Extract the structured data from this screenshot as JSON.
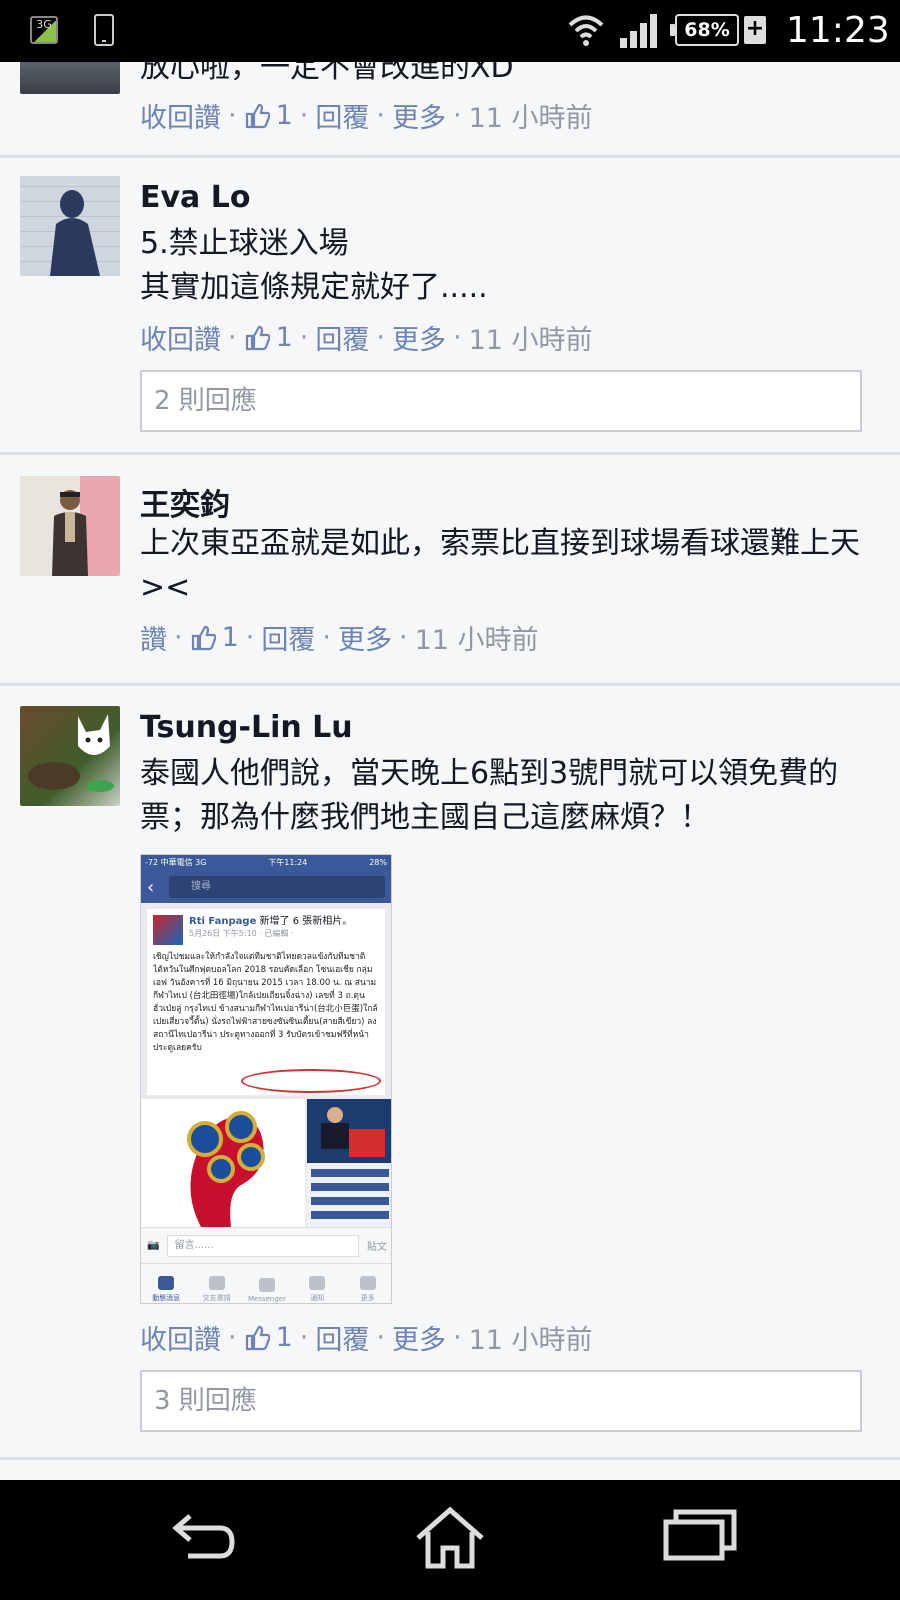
{
  "status_bar": {
    "network": "3G",
    "battery": "68%",
    "charging": "+",
    "time": "11:23"
  },
  "comments": [
    {
      "author": "",
      "text": "放心啦，一定不會改進的XD",
      "actions": {
        "like": "收回讚",
        "likes": "1",
        "reply": "回覆",
        "more": "更多",
        "time": "11 小時前"
      }
    },
    {
      "author": "Eva Lo",
      "text": "5.禁止球迷入場\n其實加這條規定就好了.....",
      "actions": {
        "like": "收回讚",
        "likes": "1",
        "reply": "回覆",
        "more": "更多",
        "time": "11 小時前"
      },
      "replies": "2 則回應"
    },
    {
      "author": "王奕鈞",
      "text": "上次東亞盃就是如此，索票比直接到球場看球還難上天><",
      "actions": {
        "like": "讚",
        "likes": "1",
        "reply": "回覆",
        "more": "更多",
        "time": "11 小時前"
      }
    },
    {
      "author": "Tsung-Lin Lu",
      "text": "泰國人他們說，當天晚上6點到3號門就可以領免費的票；那為什麼我們地主國自己這麼麻煩？！",
      "actions": {
        "like": "收回讚",
        "likes": "1",
        "reply": "回覆",
        "more": "更多",
        "time": "11 小時前"
      },
      "replies": "3 則回應",
      "attachment": {
        "status_left": "-72 中華電信 3G",
        "status_mid": "下午11:24",
        "status_right": "28%",
        "search_placeholder": "搜尋",
        "page_name": "Rti Fanpage",
        "page_action": "新增了 6 張新相片。",
        "page_date": "5月26日 下午5:10 · 已編輯 ·",
        "thai_text": "เชิญไปชมและให้กำลังใจแด่ทีมชาติไทยดวลแข้งกับทีมชาติไต้หวันในศึกฟุตบอลโลก 2018 รอบคัดเลือก โซนเอเชีย กลุ่มเอฟ วันอังคารที่ 16 มิถุนายน 2015 เวลา 18.00 น. ณ สนามกีฬาไทเป (台北田徑場)ใกล้เปยเถียนจิ๋งฉ่าง) เลขที่ 3 ถ.ตุนฮั่วเป่ยลู่ กรุงไทเป ข้างสนามกีฬาไทเปอารีน่า(台北小巨蛋)ใกล้เปยเสี่ยวจวี้ตั้น) นั่งรถไฟฟ้าสายซงซันซินเตี้ยน(สายสีเขียว) ลงสถานีไทเปอารีน่า ประตูทางออกที่ 3 รับบัตรเข้าชมฟรีที่หน้าประตูเลยครับ",
        "comment_placeholder": "留言......",
        "post_label": "貼文",
        "tabs": [
          "動態消息",
          "交友邀請",
          "Messenger",
          "通知",
          "更多"
        ]
      }
    }
  ]
}
